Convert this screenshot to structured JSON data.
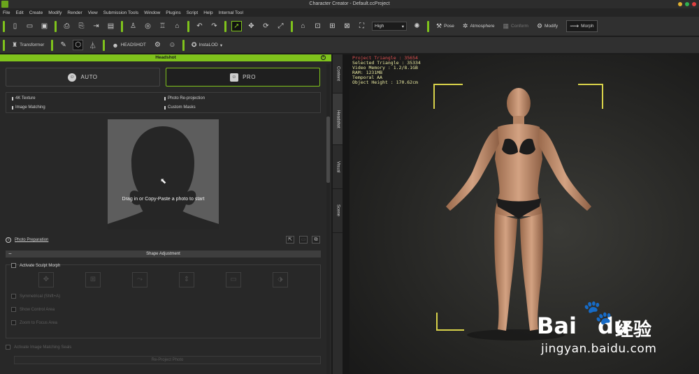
{
  "window": {
    "title": "Character Creator - Default.ccProject"
  },
  "menu": [
    "File",
    "Edit",
    "Create",
    "Modify",
    "Render",
    "View",
    "Submission Tools",
    "Window",
    "Plugins",
    "Script",
    "Help",
    "Internal Tool"
  ],
  "toolbar1": {
    "quality_value": "High",
    "pose_label": "Pose",
    "atmosphere_label": "Atmosphere",
    "conform_label": "Conform",
    "modify_label": "Modify",
    "morph_label": "Morph"
  },
  "toolbar2": {
    "transformer_label": "Transformer",
    "headshot_label": "HEADSHOT",
    "instalod_label": "InstaLOD"
  },
  "panel": {
    "title": "Headshot",
    "auto_label": "AUTO",
    "pro_label": "PRO",
    "features": [
      "4K Texture",
      "Photo Re-projection",
      "Image Matching",
      "Custom Masks"
    ],
    "dropzone_text": "Drag in or Copy-Paste a photo to start",
    "photo_prep_label": "Photo Preparation",
    "shape_header": "Shape Adjustment",
    "activate_sculpt": "Activate Sculpt Morph",
    "symmetrical": "Symmetrical (Shift+A)",
    "show_control": "Show Control Area",
    "zoom_focus": "Zoom to Focus Area",
    "activate_image_matching": "Activate Image Matching Seals",
    "reproject_label": "Re-Project Photo"
  },
  "side_tabs": [
    "Content",
    "Headshot",
    "Visual",
    "Scene"
  ],
  "viewport": {
    "stats": [
      "Project Triangle : 35654",
      "Selected Triangle : 35334",
      "Video Memory : 1.2/8.1GB",
      "RAM: 1231MB",
      "Temporal AA",
      "Object Height : 170.62cm"
    ],
    "watermark_brand": "Bai",
    "watermark_brand2": "du",
    "watermark_cn": "经验",
    "watermark_url": "jingyan.baidu.com"
  },
  "colors": {
    "accent": "#7fc31c",
    "stats_text": "#e8e8a0",
    "stats_highlight": "#e05050",
    "bbox_corners": "#d8d24a"
  }
}
